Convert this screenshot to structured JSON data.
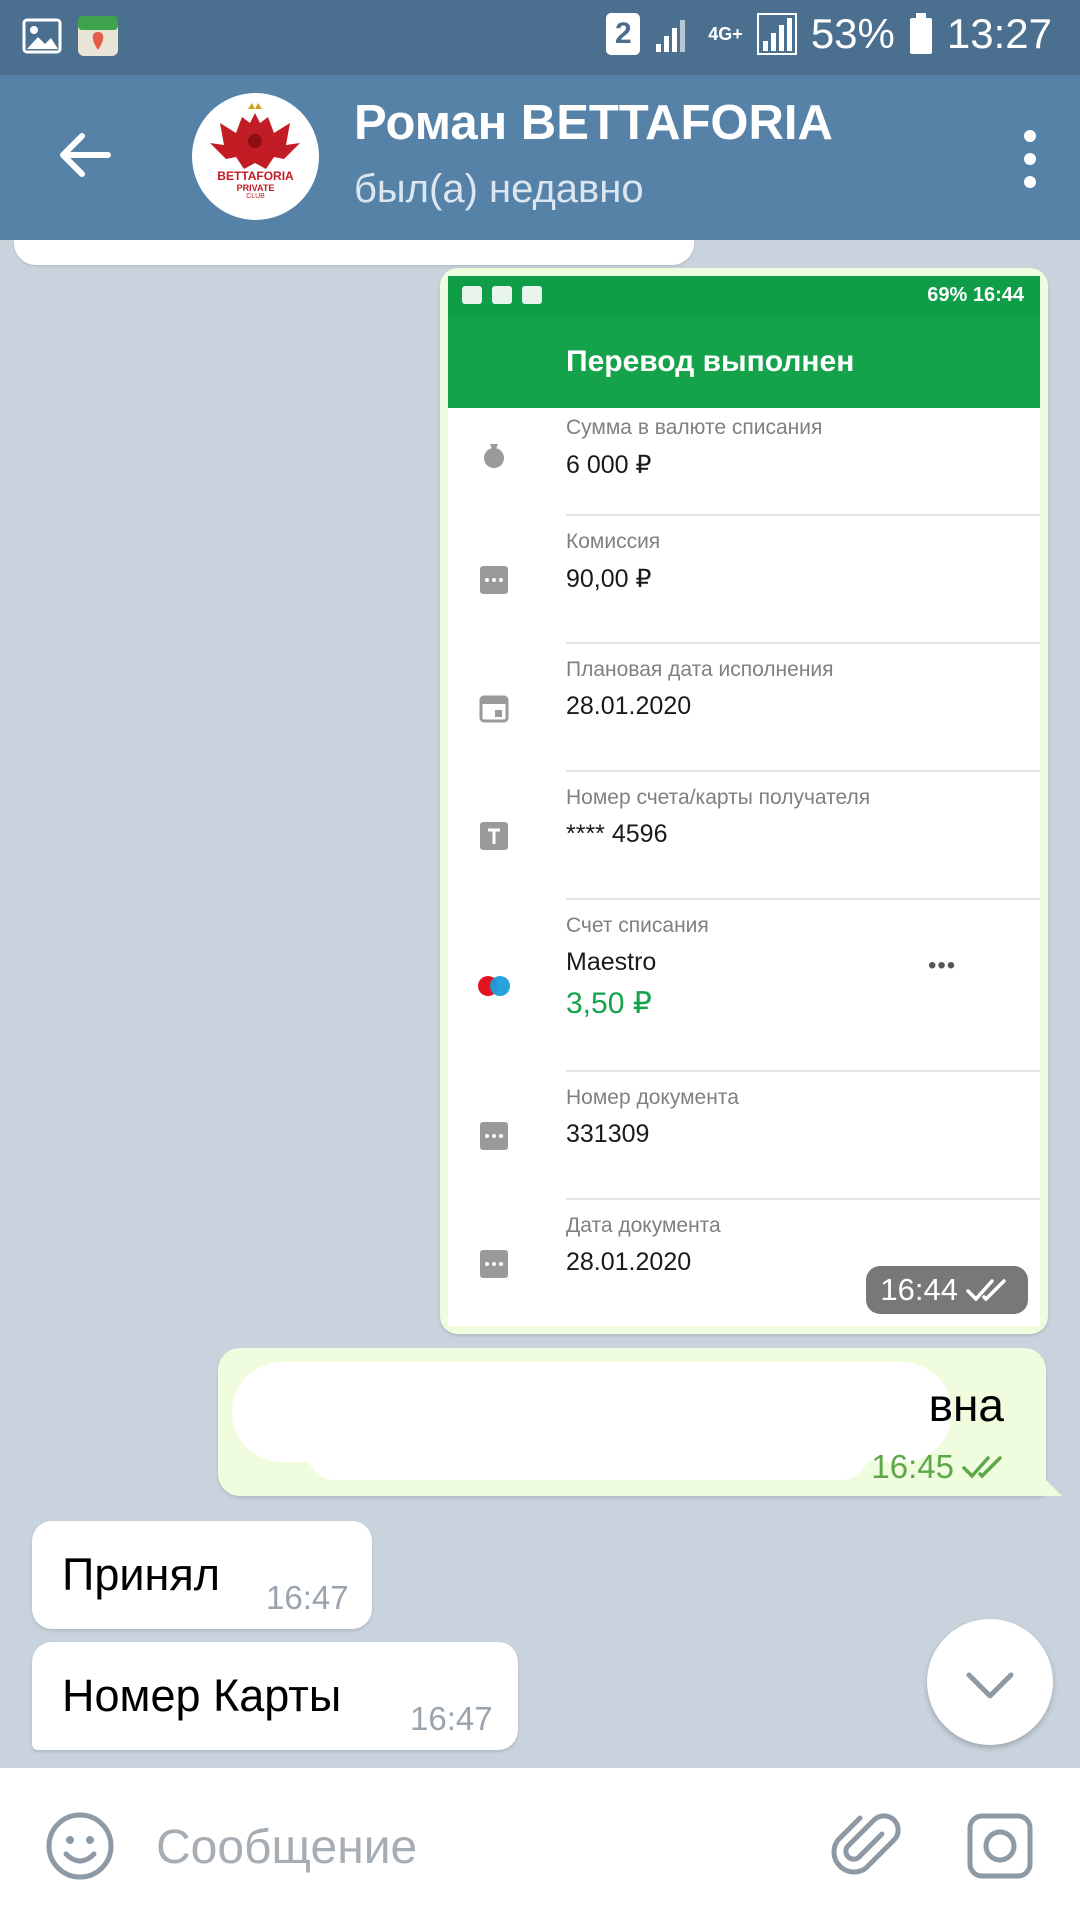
{
  "status_bar": {
    "sim_badge": "2",
    "network": "4G+",
    "battery": "53%",
    "time": "13:27"
  },
  "header": {
    "title": "Роман BETTAFORIA",
    "subtitle": "был(а) недавно",
    "avatar_text": "BETTAFORIA",
    "avatar_subtext_1": "PRIVATE",
    "avatar_subtext_2": "CLUB"
  },
  "image_message": {
    "status_bar": {
      "battery": "69%",
      "time": "16:44"
    },
    "appbar_title": "Перевод выполнен",
    "rows": [
      {
        "label": "Сумма в валюте списания",
        "value": "6 000 ₽",
        "icon": "money-bag-icon"
      },
      {
        "label": "Комиссия",
        "value": "90,00 ₽",
        "icon": "more-box-icon"
      },
      {
        "label": "Плановая дата исполнения",
        "value": "28.01.2020",
        "icon": "calendar-icon"
      },
      {
        "label": "Номер счета/карты получателя",
        "value": "**** 4596",
        "icon": "text-box-icon"
      },
      {
        "label": "Счет списания",
        "value": "Maestro",
        "balance": "3,50 ₽",
        "icon": "maestro-icon"
      },
      {
        "label": "Номер документа",
        "value": "331309",
        "icon": "more-box-icon"
      },
      {
        "label": "Дата документа",
        "value": "28.01.2020",
        "icon": "more-box-icon"
      }
    ],
    "time": "16:44"
  },
  "outgoing_message": {
    "visible_text": "вна",
    "time": "16:45"
  },
  "incoming_messages": [
    {
      "text": "Принял",
      "time": "16:47"
    },
    {
      "text": "Номер Карты",
      "time": "16:47"
    }
  ],
  "input_bar": {
    "placeholder": "Сообщение"
  },
  "colors": {
    "header": "#5682a8",
    "status_bar": "#4a6f8f",
    "outgoing_bubble": "#effdde",
    "sber_green": "#14a34a"
  }
}
